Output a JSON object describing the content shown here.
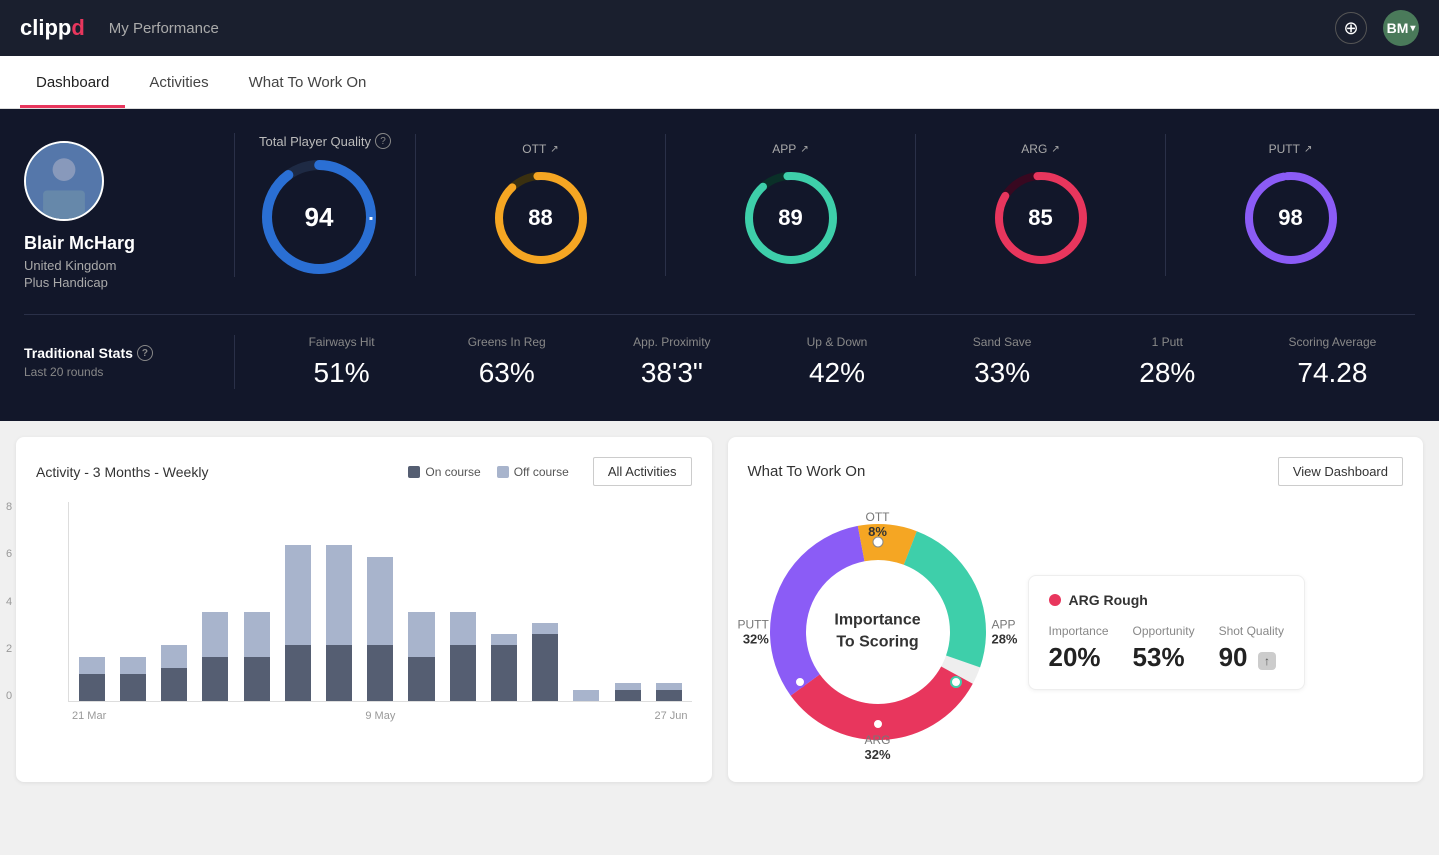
{
  "header": {
    "logo": "clippd",
    "logo_clip": "clipp",
    "logo_d": "d",
    "title": "My Performance",
    "add_btn_label": "+",
    "avatar_label": "B"
  },
  "nav": {
    "tabs": [
      {
        "label": "Dashboard",
        "active": true
      },
      {
        "label": "Activities",
        "active": false
      },
      {
        "label": "What To Work On",
        "active": false
      }
    ]
  },
  "player": {
    "name": "Blair McHarg",
    "country": "United Kingdom",
    "handicap": "Plus Handicap"
  },
  "tpq": {
    "label": "Total Player Quality",
    "value": 94,
    "segments": [
      {
        "label": "OTT",
        "value": 88,
        "color": "#f5a623",
        "trackColor": "#3a3010"
      },
      {
        "label": "APP",
        "value": 89,
        "color": "#3ecfaa",
        "trackColor": "#0a3028"
      },
      {
        "label": "ARG",
        "value": 85,
        "color": "#e8365d",
        "trackColor": "#380820"
      },
      {
        "label": "PUTT",
        "value": 98,
        "color": "#8b5cf6",
        "trackColor": "#2a1060"
      }
    ]
  },
  "traditional_stats": {
    "title": "Traditional Stats",
    "subtitle": "Last 20 rounds",
    "items": [
      {
        "label": "Fairways Hit",
        "value": "51%"
      },
      {
        "label": "Greens In Reg",
        "value": "63%"
      },
      {
        "label": "App. Proximity",
        "value": "38'3\""
      },
      {
        "label": "Up & Down",
        "value": "42%"
      },
      {
        "label": "Sand Save",
        "value": "33%"
      },
      {
        "label": "1 Putt",
        "value": "28%"
      },
      {
        "label": "Scoring Average",
        "value": "74.28"
      }
    ]
  },
  "activity_chart": {
    "title": "Activity - 3 Months - Weekly",
    "legend": [
      {
        "label": "On course",
        "color": "#555e72"
      },
      {
        "label": "Off course",
        "color": "#a8b4cc"
      }
    ],
    "all_activities_btn": "All Activities",
    "y_labels": [
      "8",
      "6",
      "4",
      "2",
      "0"
    ],
    "x_labels": [
      "21 Mar",
      "9 May",
      "27 Jun"
    ],
    "bars": [
      {
        "on": 1.2,
        "off": 0.8
      },
      {
        "on": 1.2,
        "off": 0.8
      },
      {
        "on": 1.5,
        "off": 1.0
      },
      {
        "on": 2.0,
        "off": 2.0
      },
      {
        "on": 2.0,
        "off": 2.0
      },
      {
        "on": 2.5,
        "off": 4.5
      },
      {
        "on": 2.5,
        "off": 4.5
      },
      {
        "on": 2.5,
        "off": 4.0
      },
      {
        "on": 2.0,
        "off": 2.0
      },
      {
        "on": 2.5,
        "off": 1.5
      },
      {
        "on": 2.5,
        "off": 0.5
      },
      {
        "on": 3.0,
        "off": 0.5
      },
      {
        "on": 0.0,
        "off": 0.5
      },
      {
        "on": 0.5,
        "off": 0.3
      },
      {
        "on": 0.5,
        "off": 0.3
      }
    ]
  },
  "wtwo": {
    "title": "What To Work On",
    "view_dashboard_btn": "View Dashboard",
    "donut_center": "Importance\nTo Scoring",
    "segments": [
      {
        "label": "OTT",
        "pct": "8%",
        "color": "#f5a623"
      },
      {
        "label": "APP",
        "pct": "28%",
        "color": "#3ecfaa"
      },
      {
        "label": "ARG",
        "pct": "32%",
        "color": "#e8365d"
      },
      {
        "label": "PUTT",
        "pct": "32%",
        "color": "#8b5cf6"
      }
    ],
    "info_card": {
      "title": "ARG Rough",
      "dot_color": "#e8365d",
      "metrics": [
        {
          "label": "Importance",
          "value": "20%"
        },
        {
          "label": "Opportunity",
          "value": "53%"
        },
        {
          "label": "Shot Quality",
          "value": "90",
          "badge": "↑"
        }
      ]
    }
  }
}
